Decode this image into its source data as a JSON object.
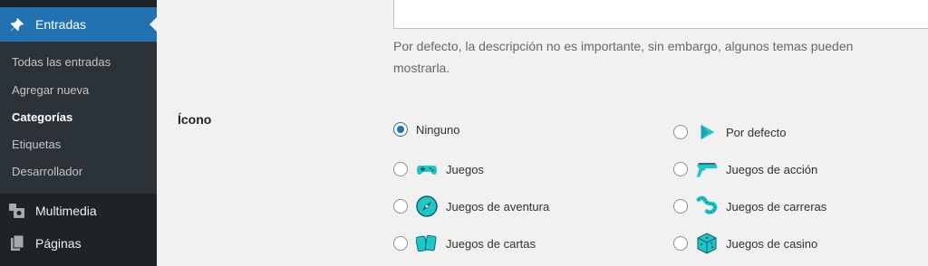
{
  "sidebar": {
    "entradas": {
      "label": "Entradas",
      "icon": "pushpin-icon"
    },
    "submenu": [
      {
        "label": "Todas las entradas",
        "current": false
      },
      {
        "label": "Agregar nueva",
        "current": false
      },
      {
        "label": "Categorías",
        "current": true
      },
      {
        "label": "Etiquetas",
        "current": false
      },
      {
        "label": "Desarrollador",
        "current": false
      }
    ],
    "multimedia": {
      "label": "Multimedia",
      "icon": "media-icon"
    },
    "paginas": {
      "label": "Páginas",
      "icon": "page-icon"
    }
  },
  "main": {
    "description": "Por defecto, la descripción no es importante, sin embargo, algunos temas pueden mostrarla.",
    "icon_field": {
      "label": "Ícono",
      "selected": "Ninguno",
      "options": [
        {
          "label": "Ninguno",
          "icon": null
        },
        {
          "label": "Por defecto",
          "icon": "play-icon"
        },
        {
          "label": "Juegos",
          "icon": "gamepad-icon"
        },
        {
          "label": "Juegos de acción",
          "icon": "gun-icon"
        },
        {
          "label": "Juegos de aventura",
          "icon": "compass-icon"
        },
        {
          "label": "Juegos de carreras",
          "icon": "race-track-icon"
        },
        {
          "label": "Juegos de cartas",
          "icon": "cards-icon"
        },
        {
          "label": "Juegos de casino",
          "icon": "dice-icon"
        }
      ]
    }
  },
  "colors": {
    "sidebar": "#1d2327",
    "submenu": "#2c3338",
    "accent": "#2271b1",
    "icon_teal": "#1fc6c6"
  }
}
